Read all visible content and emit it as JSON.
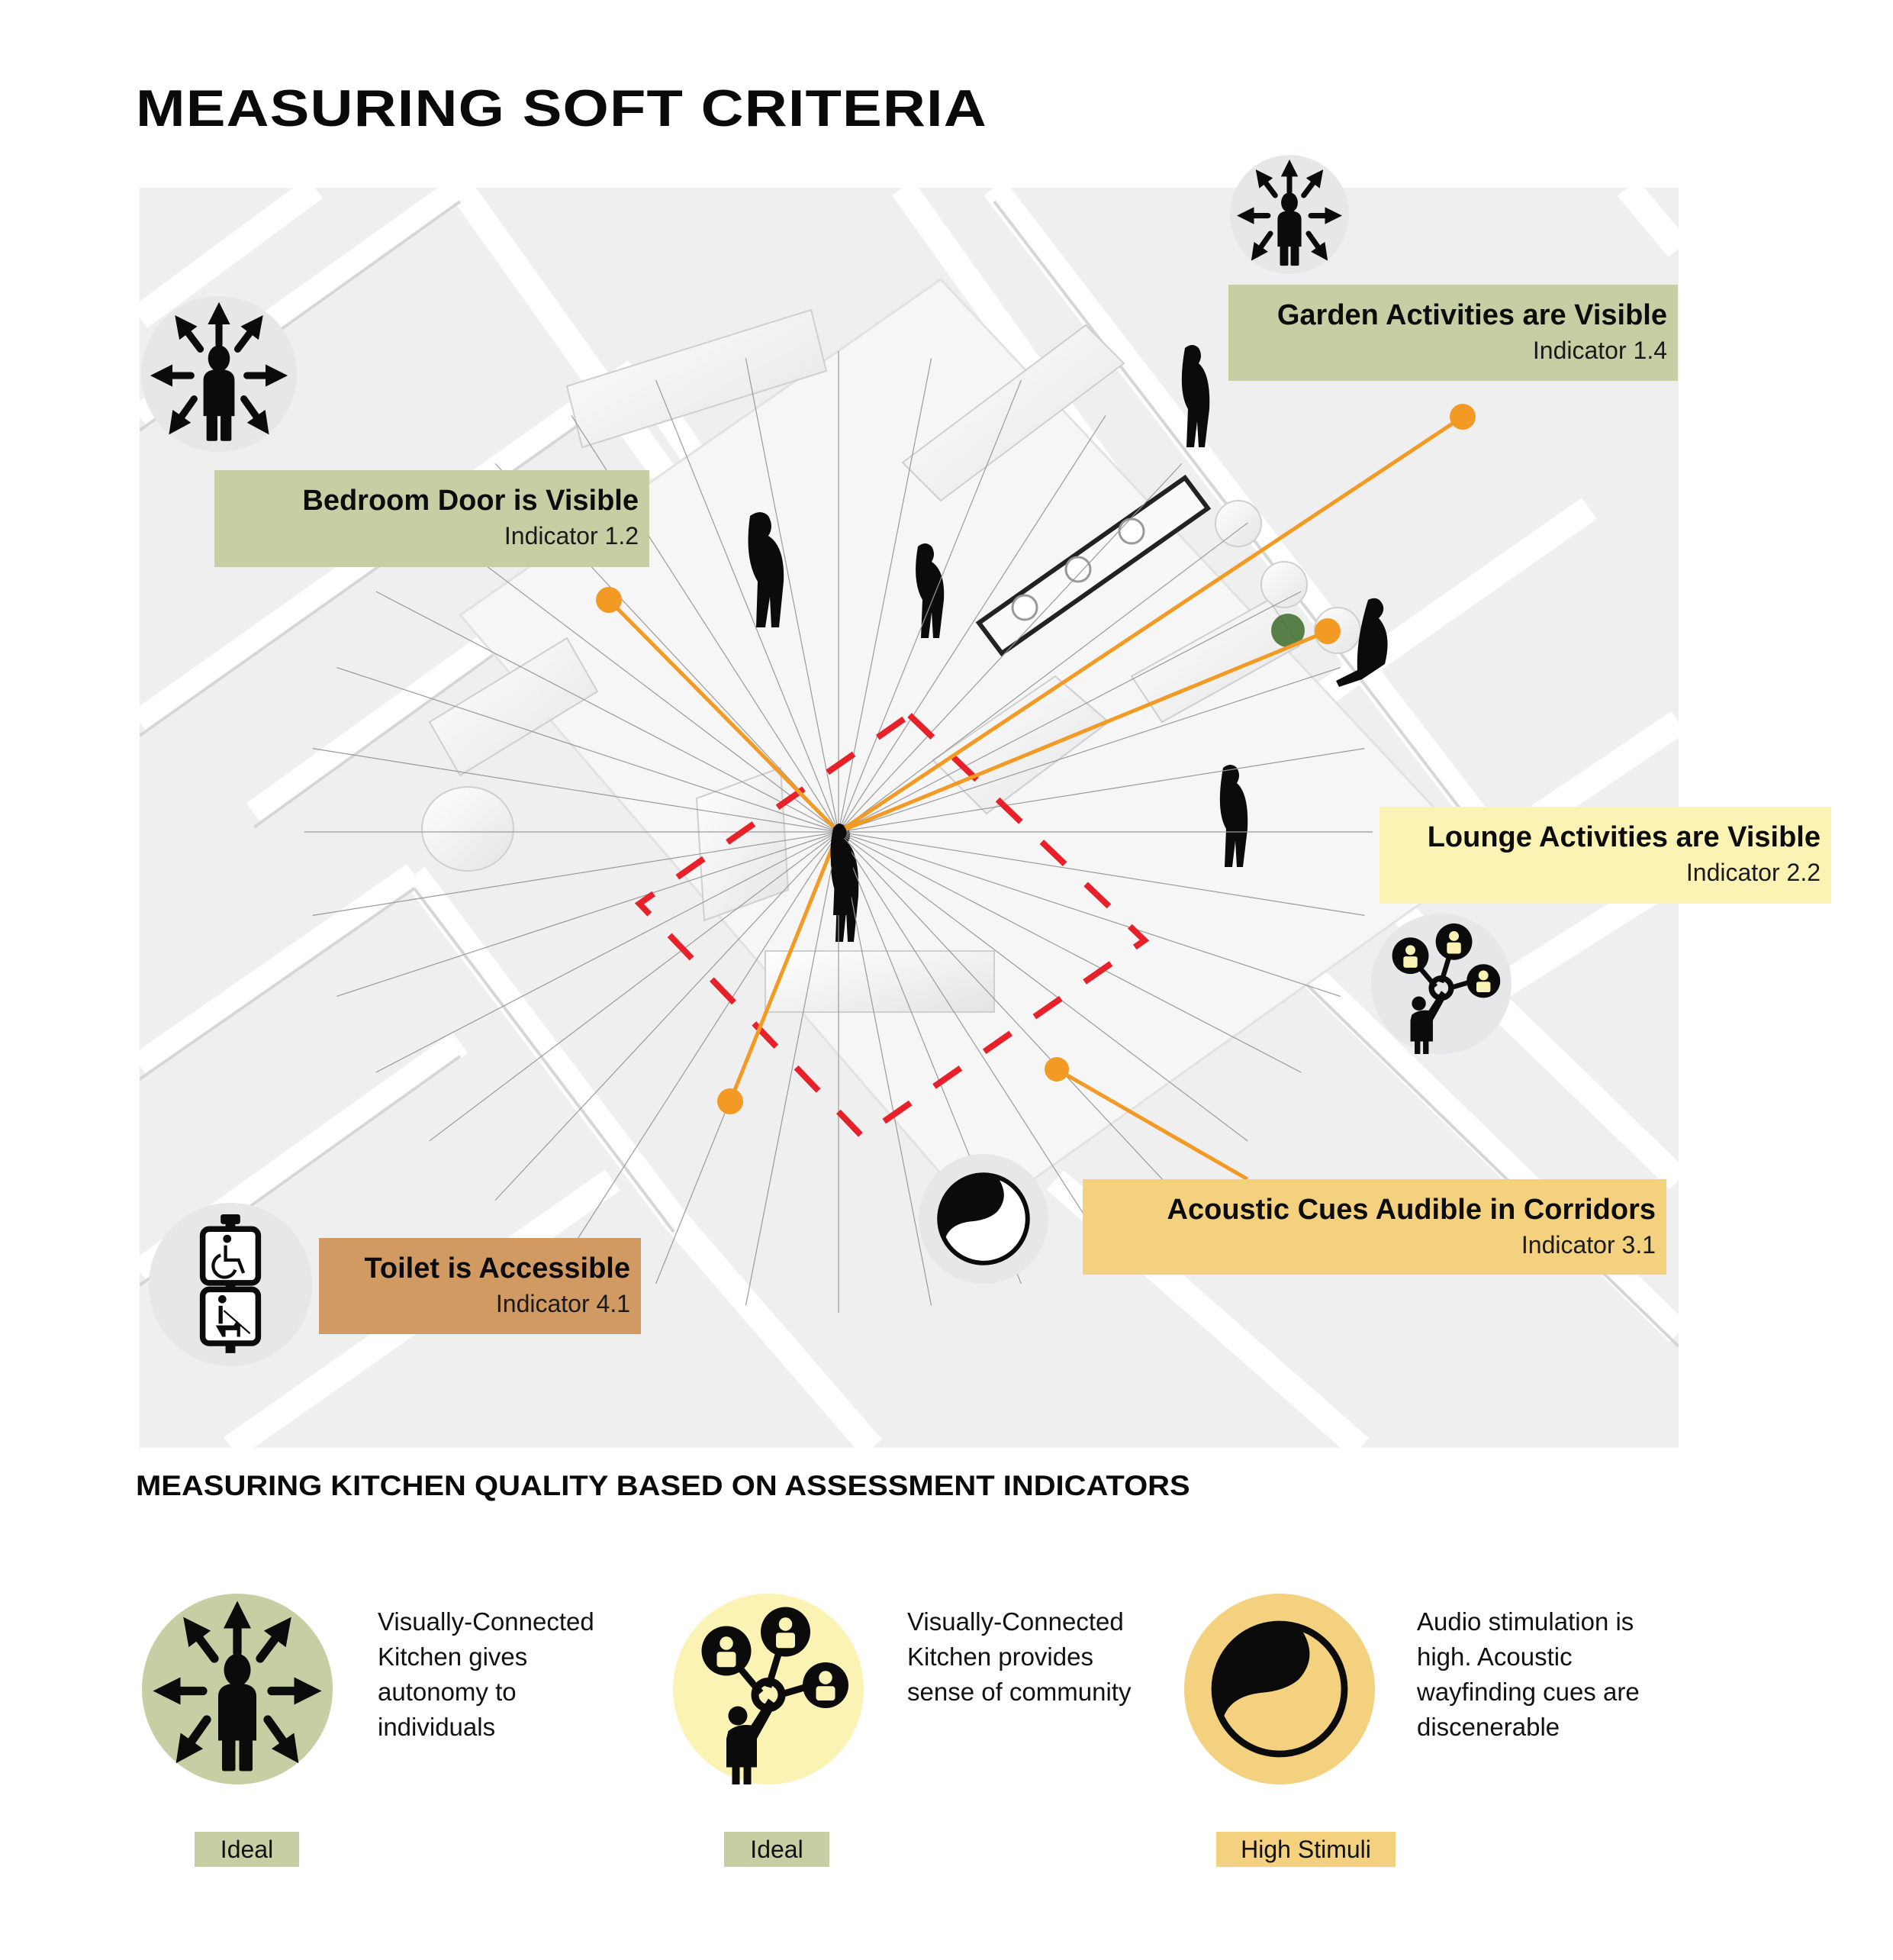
{
  "title": "MEASURING SOFT CRITERIA",
  "subtitle": "MEASURING KITCHEN QUALITY BASED ON ASSESSMENT INDICATORS",
  "colors": {
    "sage": "#c6cfa3",
    "pale_yellow": "#fbf3b4",
    "gold": "#f3d17e",
    "tan": "#d09a62",
    "orange_line": "#f39a25",
    "red_dash": "#e8202a",
    "icon_bg": "#e6e7e8"
  },
  "indicators": [
    {
      "title": "Bedroom Door is Visible",
      "indicator": "Indicator 1.2",
      "icon": "person-radiating-arrows-icon",
      "color": "sage"
    },
    {
      "title": "Garden Activities are Visible",
      "indicator": "Indicator 1.4",
      "icon": "person-radiating-arrows-icon",
      "color": "sage"
    },
    {
      "title": "Lounge Activities are Visible",
      "indicator": "Indicator 2.2",
      "icon": "community-network-icon",
      "color": "pale_yellow"
    },
    {
      "title": "Acoustic Cues Audible in Corridors",
      "indicator": "Indicator 3.1",
      "icon": "acoustic-swirl-icon",
      "color": "gold"
    },
    {
      "title": "Toilet is Accessible",
      "indicator": "Indicator 4.1",
      "icon": "accessibility-sign-icon",
      "color": "tan"
    }
  ],
  "legend": [
    {
      "description": "Visually-Connected\nKitchen gives\nautonomy to\nindividuals",
      "rating": "Ideal",
      "icon": "person-radiating-arrows-icon",
      "circle_color": "sage",
      "badge_color": "sage"
    },
    {
      "description": "Visually-Connected\nKitchen provides\nsense of community",
      "rating": "Ideal",
      "icon": "community-network-icon",
      "circle_color": "pale_yellow",
      "badge_color": "sage"
    },
    {
      "description": "Audio stimulation is\nhigh. Acoustic\nwayfinding cues are\ndiscenerable",
      "rating": "High Stimuli",
      "icon": "acoustic-swirl-icon",
      "circle_color": "gold",
      "badge_color": "gold"
    }
  ]
}
